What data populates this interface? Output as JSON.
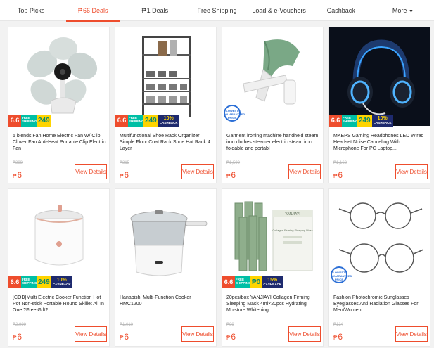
{
  "tabs": [
    {
      "prefix": "",
      "label": "Top Picks"
    },
    {
      "prefix": "₱",
      "label": "66 Deals"
    },
    {
      "prefix": "₱",
      "label": "1 Deals"
    },
    {
      "prefix": "",
      "label": "Free Shipping"
    },
    {
      "prefix": "",
      "label": "Load & e-Vouchers"
    },
    {
      "prefix": "",
      "label": "Cashback"
    },
    {
      "prefix": "",
      "label": "More"
    }
  ],
  "active_tab": "66 Deals",
  "promo": {
    "sale": "6.6",
    "free_shipping": "FREE SHIPPING",
    "min": "Min. spend",
    "value_249": "249",
    "value_0": "₱0",
    "cashback_label": "CASHBACK",
    "cash_10": "10%",
    "cash_15": "15%",
    "lowest_price": "LOWEST GUARANTEED PRICE"
  },
  "products": [
    {
      "title": "5 blends Fan Home Electric Fan W/ Clip Clover Fan Anti-Heat Portable Clip Electric Fan",
      "old_price": "₱399",
      "currency": "₱",
      "price": "6",
      "button": "View Details"
    },
    {
      "title": "Multifunctional Shoe Rack Organizer Simple Floor Coat Rack Shoe Hat Rack 4 Layer",
      "old_price": "₱315",
      "currency": "₱",
      "price": "6",
      "button": "View Details"
    },
    {
      "title": "Garment ironing machine handheld steam iron clothes steamer electric steam iron foldable and portabl",
      "old_price": "₱1,599",
      "currency": "₱",
      "price": "6",
      "button": "View Details"
    },
    {
      "title": "MKEPS Gaming Headphones LED Wired Headset Noise Canceling With Microphone For PC Laptop...",
      "old_price": "₱1,163",
      "currency": "₱",
      "price": "6",
      "button": "View Details"
    },
    {
      "title": "[COD]Multi Electric Cooker Function Hot Pot Non-stick Portable Round Skillet All In One ?Free Gift?",
      "old_price": "₱2,999",
      "currency": "₱",
      "price": "6",
      "button": "View Details"
    },
    {
      "title": "Hanabishi Multi-Function Cooker HMC1200",
      "old_price": "₱1,010",
      "currency": "₱",
      "price": "6",
      "button": "View Details"
    },
    {
      "title": "20pcs/box YANJIAYI Collagen Firming Sleeping Mask 4ml×20pcs Hydrating Moisture Whitening...",
      "old_price": "₱99",
      "currency": "₱",
      "price": "6",
      "button": "View Details"
    },
    {
      "title": "Fashion Photochromic Sunglasses Eyeglasses Anti Radiation Glasses For Men/Women",
      "old_price": "₱134",
      "currency": "₱",
      "price": "6",
      "button": "View Details"
    }
  ],
  "product_packaging": {
    "brand": "YANJIAYI",
    "sub": "Collagen Firming Sleeping Mask"
  },
  "colors": {
    "accent": "#ee4d2d",
    "teal": "#00bfa5",
    "yellow": "#ffd400",
    "navy": "#1e2a6e"
  }
}
